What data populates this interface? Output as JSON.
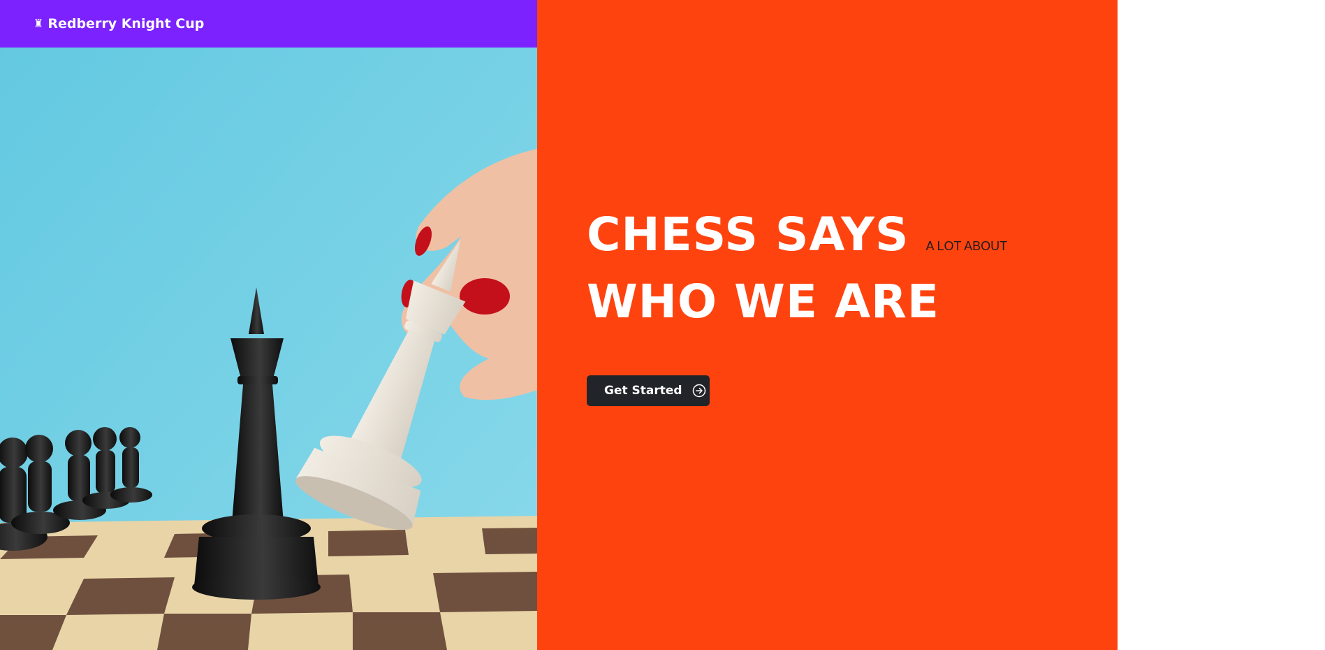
{
  "header": {
    "brand_icon": "chess-rook-icon",
    "brand_icon_glyph": "♜",
    "brand_name": "Redberry Knight Cup"
  },
  "hero": {
    "image": "chess-board-hand-moving-white-king-over-blue-sky"
  },
  "headline": {
    "line1_big": "CHESS SAYS",
    "line1_small": "A LOT ABOUT",
    "line2_big": "WHO WE ARE"
  },
  "cta": {
    "label": "Get Started",
    "icon": "arrow-right-circle-icon"
  },
  "colors": {
    "header_bg": "#7b22ff",
    "panel_bg": "#ff430f",
    "button_bg": "#212529",
    "sky": "#6fd0e4"
  }
}
